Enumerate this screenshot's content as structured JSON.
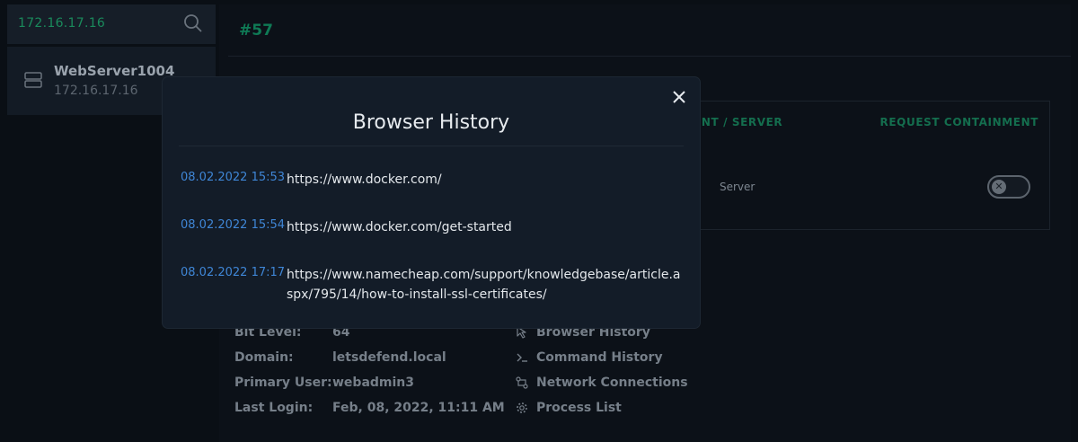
{
  "search": {
    "value": "172.16.17.16"
  },
  "host": {
    "name": "WebServer1004",
    "ip": "172.16.17.16"
  },
  "main": {
    "title": "#57",
    "table": {
      "headers": {
        "client_server": "IENT / SERVER",
        "request_containment": "REQUEST CONTAINMENT"
      },
      "row": {
        "type": "Server",
        "containment_enabled": false
      }
    },
    "info": [
      {
        "label": "Bit Level:",
        "value": "64"
      },
      {
        "label": "Domain:",
        "value": "letsdefend.local"
      },
      {
        "label": "Primary User:",
        "value": "webadmin3"
      },
      {
        "label": "Last Login:",
        "value": "Feb, 08, 2022, 11:11 AM"
      }
    ],
    "actions": [
      {
        "label": "Browser History",
        "icon": "cursor-icon"
      },
      {
        "label": "Command History",
        "icon": "terminal-icon"
      },
      {
        "label": "Network Connections",
        "icon": "network-icon"
      },
      {
        "label": "Process List",
        "icon": "gear-icon"
      }
    ]
  },
  "modal": {
    "title": "Browser History",
    "entries": [
      {
        "timestamp": "08.02.2022 15:53",
        "url": "https://www.docker.com/"
      },
      {
        "timestamp": "08.02.2022 15:54",
        "url": "https://www.docker.com/get-started"
      },
      {
        "timestamp": "08.02.2022 17:17",
        "url": "https://www.namecheap.com/support/knowledgebase/article.aspx/795/14/how-to-install-ssl-certificates/"
      }
    ]
  },
  "colors": {
    "accent_green": "#0f7a55",
    "link_blue": "#3f86d6",
    "background": "#0a0f15"
  }
}
